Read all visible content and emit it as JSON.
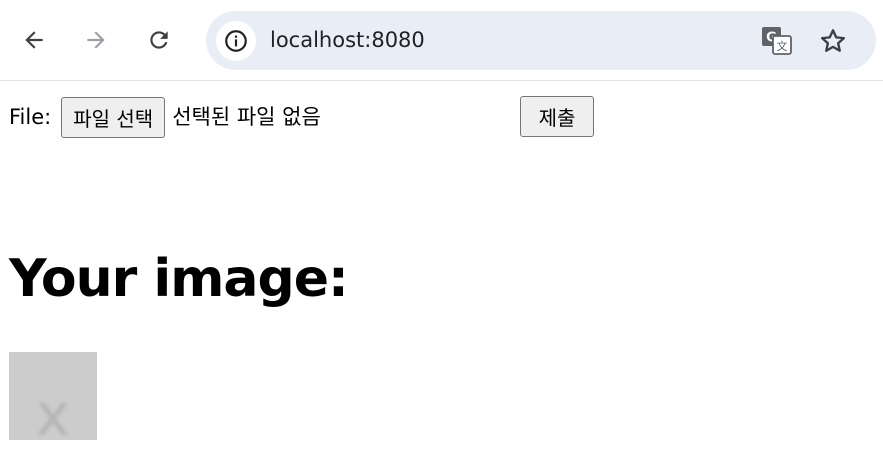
{
  "browser": {
    "url": "localhost:8080",
    "icons": {
      "back": "arrow-left-icon",
      "forward": "arrow-right-icon",
      "reload": "reload-icon",
      "site_info": "info-icon",
      "translate": "translate-icon",
      "bookmark": "star-icon"
    }
  },
  "form": {
    "file_label": "File:",
    "choose_button": "파일 선택",
    "no_file_text": "선택된 파일 없음",
    "submit_button": "제출"
  },
  "main": {
    "heading": "Your image:",
    "image_placeholder": "x"
  },
  "colors": {
    "omnibox_bg": "#e9edf6",
    "button_bg": "#efefef",
    "image_placeholder_bg": "#cccccc"
  }
}
